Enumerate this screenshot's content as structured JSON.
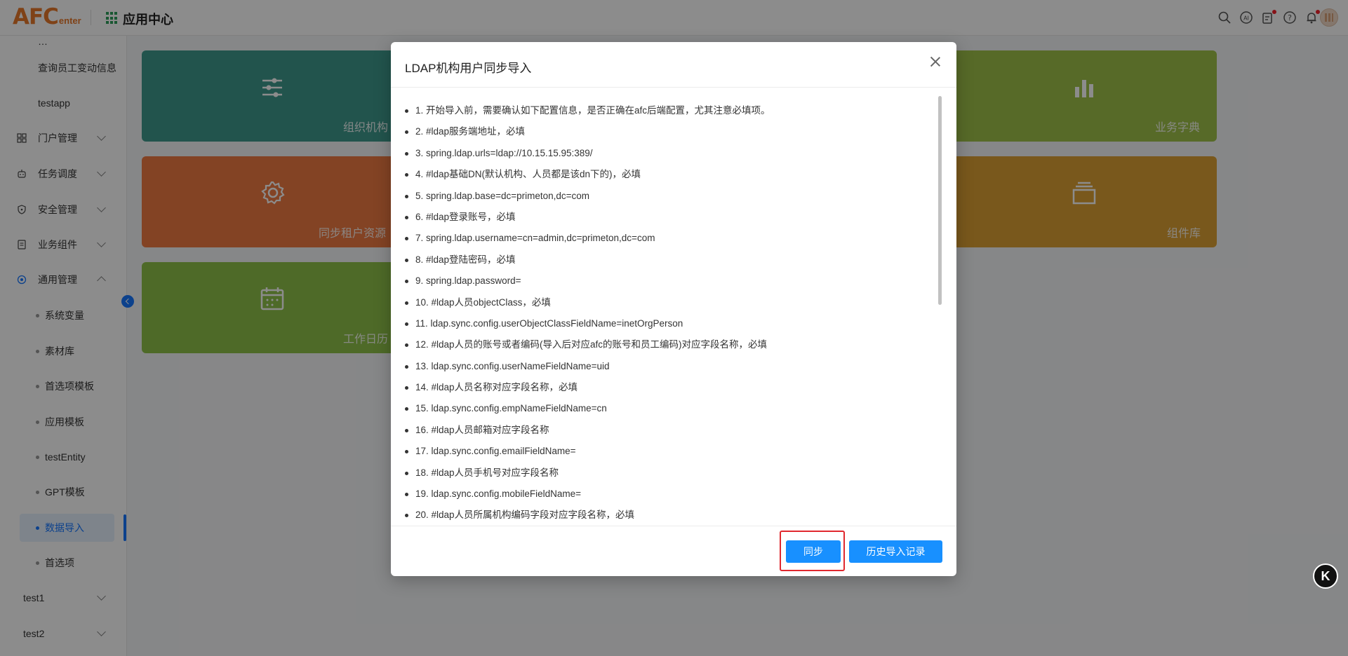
{
  "header": {
    "logo_main": "AFC",
    "logo_sub": "enter",
    "app_title": "应用中心"
  },
  "sidebar": {
    "items": [
      {
        "label": "…"
      },
      {
        "label": "查询员工变动信息"
      },
      {
        "label": "testapp"
      },
      {
        "label": "门户管理"
      },
      {
        "label": "任务调度"
      },
      {
        "label": "安全管理"
      },
      {
        "label": "业务组件"
      },
      {
        "label": "通用管理"
      },
      {
        "label": "系统变量"
      },
      {
        "label": "素材库"
      },
      {
        "label": "首选项模板"
      },
      {
        "label": "应用模板"
      },
      {
        "label": "testEntity"
      },
      {
        "label": "GPT模板"
      },
      {
        "label": "数据导入"
      },
      {
        "label": "首选项"
      },
      {
        "label": "test1"
      },
      {
        "label": "test2"
      }
    ]
  },
  "cards": [
    {
      "label": "组织机构",
      "color": "#3f9a8c"
    },
    {
      "label": "同步租户资源",
      "color": "#ee7a43"
    },
    {
      "label": "工作日历",
      "color": "#8ec24a"
    },
    {
      "label": "业务字典",
      "color": "#9ec24a"
    },
    {
      "label": "组件库",
      "color": "#dda034"
    }
  ],
  "modal": {
    "title": "LDAP机构用户同步导入",
    "steps": [
      "1. 开始导入前，需要确认如下配置信息，是否正确在afc后端配置，尤其注意必填项。",
      "2. #ldap服务端地址，必填",
      "3. spring.ldap.urls=ldap://10.15.15.95:389/",
      "4. #ldap基础DN(默认机构、人员都是该dn下的)，必填",
      "5. spring.ldap.base=dc=primeton,dc=com",
      "6. #ldap登录账号，必填",
      "7. spring.ldap.username=cn=admin,dc=primeton,dc=com",
      "8. #ldap登陆密码，必填",
      "9. spring.ldap.password=",
      "10. #ldap人员objectClass，必填",
      "11. ldap.sync.config.userObjectClassFieldName=inetOrgPerson",
      "12. #ldap人员的账号或者编码(导入后对应afc的账号和员工编码)对应字段名称，必填",
      "13. ldap.sync.config.userNameFieldName=uid",
      "14. #ldap人员名称对应字段名称，必填",
      "15. ldap.sync.config.empNameFieldName=cn",
      "16. #ldap人员邮箱对应字段名称",
      "17. ldap.sync.config.emailFieldName=",
      "18. #ldap人员手机号对应字段名称",
      "19. ldap.sync.config.mobileFieldName=",
      "20. #ldap人员所属机构编码字段对应字段名称，必填"
    ],
    "sync_button": "同步",
    "history_button": "历史导入记录"
  },
  "float_button": "K"
}
